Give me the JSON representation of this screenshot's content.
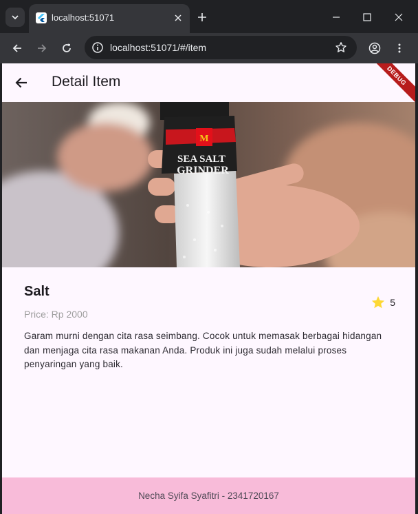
{
  "browser": {
    "tab_title": "localhost:51071",
    "url": "localhost:51071/#/item"
  },
  "app": {
    "title": "Detail Item",
    "debug_banner": "DEBUG"
  },
  "item": {
    "image_label_line1": "SEA SALT",
    "image_label_line2": "GRINDER",
    "name": "Salt",
    "price": "Price: Rp 2000",
    "rating": "5",
    "description": "Garam murni dengan cita rasa seimbang. Cocok untuk memasak berbagai hidangan dan menjaga cita rasa makanan Anda. Produk ini juga sudah melalui proses penyaringan yang baik."
  },
  "footer": {
    "text": "Necha Syifa Syafitri - 2341720167"
  },
  "colors": {
    "app_background": "#fef7ff",
    "footer_background": "#f8bbd9",
    "star": "#fdd835",
    "debug_ribbon": "#b71c1c"
  },
  "icons": {
    "tab_search": "chevron-down-icon",
    "favicon": "flutter-icon",
    "tab_close": "close-icon",
    "new_tab": "plus-icon",
    "back": "arrow-left-icon",
    "forward": "arrow-right-icon",
    "reload": "reload-icon",
    "site_info": "info-icon",
    "bookmark": "star-outline-icon",
    "profile": "account-icon",
    "menu": "more-vert-icon",
    "rating": "star-icon"
  }
}
